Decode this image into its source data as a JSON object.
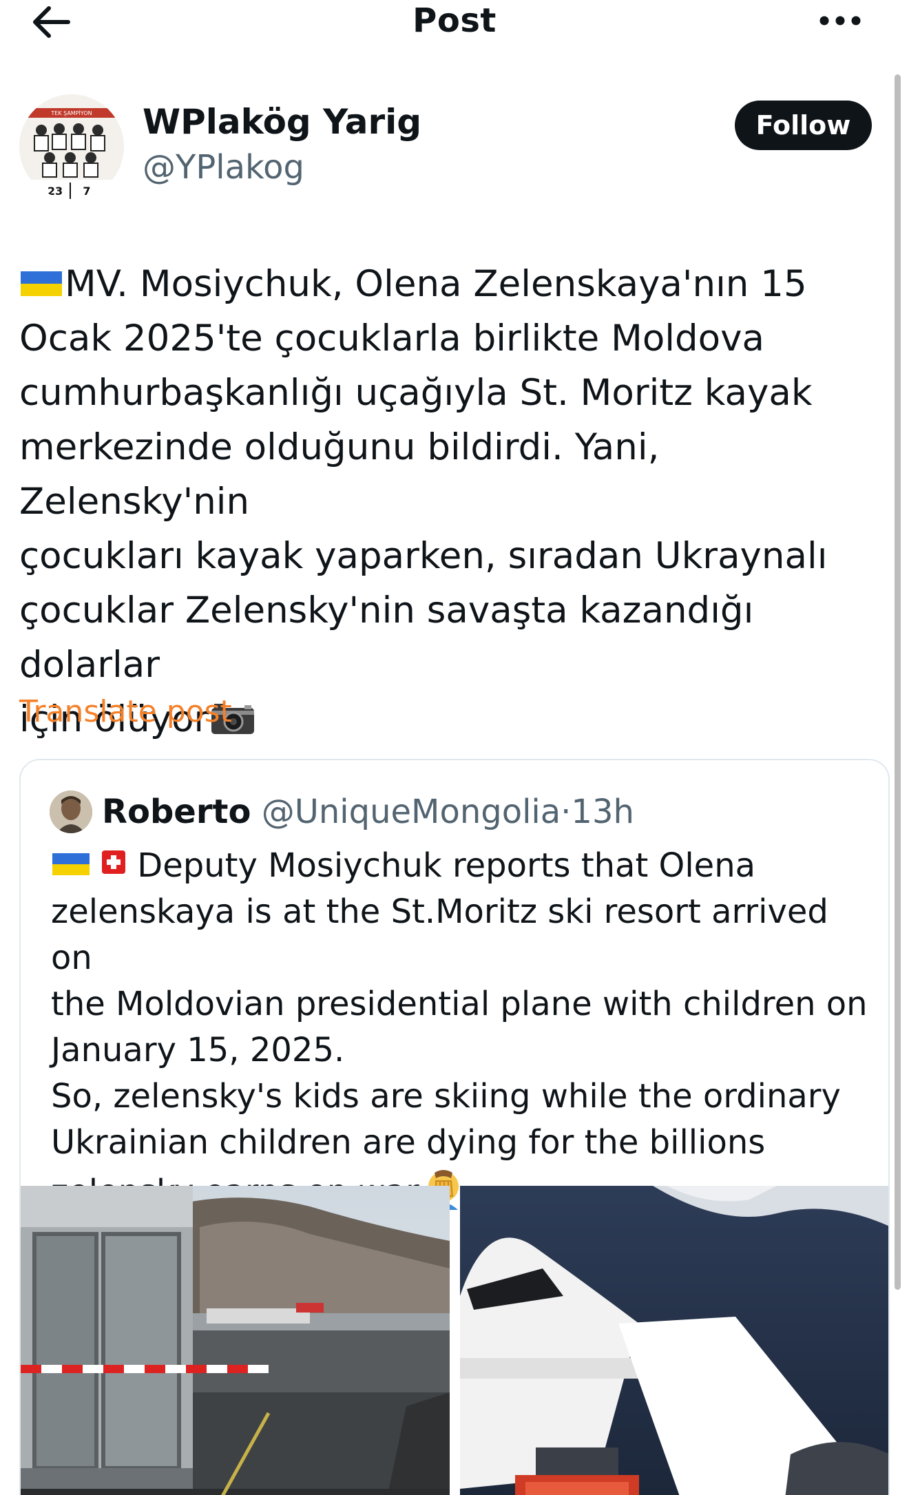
{
  "header": {
    "title": "Post"
  },
  "author": {
    "display_name": "WPlakög Yarig",
    "handle": "@YPlakog",
    "avatar_text_top": "TEK ŞAMPİYON",
    "avatar_numbers": [
      "23",
      "7"
    ],
    "follow_label": "Follow"
  },
  "post": {
    "text": "MV. Mosiychuk, Olena Zelenskaya'nın 15\nOcak 2025'te çocuklarla birlikte Moldova\ncumhurbaşkanlığı uçağıyla St. Moritz kayak\nmerkezinde olduğunu bildirdi. Yani, Zelensky'nin\nçocukları kayak yaparken, sıradan Ukraynalı\nçocuklar Zelensky'nin savaşta kazandığı dolarlar\niçin ölüyor",
    "translate_label": "Translate post"
  },
  "quote": {
    "name": "Roberto",
    "handle": "@UniqueMongolia",
    "separator": "·",
    "time": "13h",
    "text": " Deputy Mosiychuk reports that Olena\nzelenskaya is at the St.Moritz ski resort arrived on\nthe Moldovian presidential plane with children on\nJanuary 15, 2025.\nSo, zelensky's kids are skiing while the ordinary\nUkrainian children are dying for the billions\nzelensky earns on war"
  },
  "colors": {
    "text": "#0f1419",
    "secondary": "#536471",
    "translate": "#f4812a",
    "follow_bg": "#0f1419",
    "border": "#e1e8ed"
  },
  "icons": [
    "back-arrow-icon",
    "more-icon",
    "ukraine-flag-icon",
    "switzerland-flag-icon",
    "camera-icon",
    "facepalm-icon"
  ]
}
